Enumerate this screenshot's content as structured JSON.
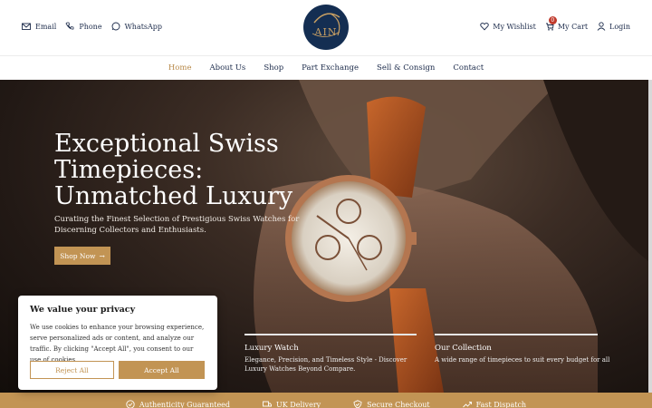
{
  "header": {
    "contacts": [
      {
        "label": "Email",
        "icon": "mail-icon"
      },
      {
        "label": "Phone",
        "icon": "phone-icon"
      },
      {
        "label": "WhatsApp",
        "icon": "whatsapp-icon"
      }
    ],
    "logo_text": "AIN",
    "account": {
      "wishlist": "My Wishlist",
      "cart": "My Cart",
      "cart_count": "0",
      "login": "Login"
    }
  },
  "nav": {
    "items": [
      "Home",
      "About Us",
      "Shop",
      "Part Exchange",
      "Sell & Consign",
      "Contact"
    ],
    "active": "Home"
  },
  "hero": {
    "title": "Exceptional Swiss Timepieces: Unmatched Luxury",
    "subtitle": "Curating the Finest Selection of Prestigious Swiss Watches for Discerning Collectors and Enthusiasts.",
    "cta": "Shop Now",
    "features": [
      {
        "title": "Luxury Watch",
        "desc": "Elegance, Precision, and Timeless Style - Discover Luxury Watches Beyond Compare."
      },
      {
        "title": "Our Collection",
        "desc": "A wide range of timepieces to suit every budget for all"
      }
    ]
  },
  "benefits": [
    "Authenticity Guaranteed",
    "UK Delivery",
    "Secure Checkout",
    "Fast Dispatch"
  ],
  "cookie": {
    "title": "We value your privacy",
    "text": "We use cookies to enhance your browsing experience, serve personalized ads or content, and analyze our traffic. By clicking \"Accept All\", you consent to our use of cookies.",
    "reject": "Reject All",
    "accept": "Accept All"
  },
  "colors": {
    "accent": "#c29454",
    "navy": "#1b2a4a",
    "logo_bg": "#142e52"
  }
}
